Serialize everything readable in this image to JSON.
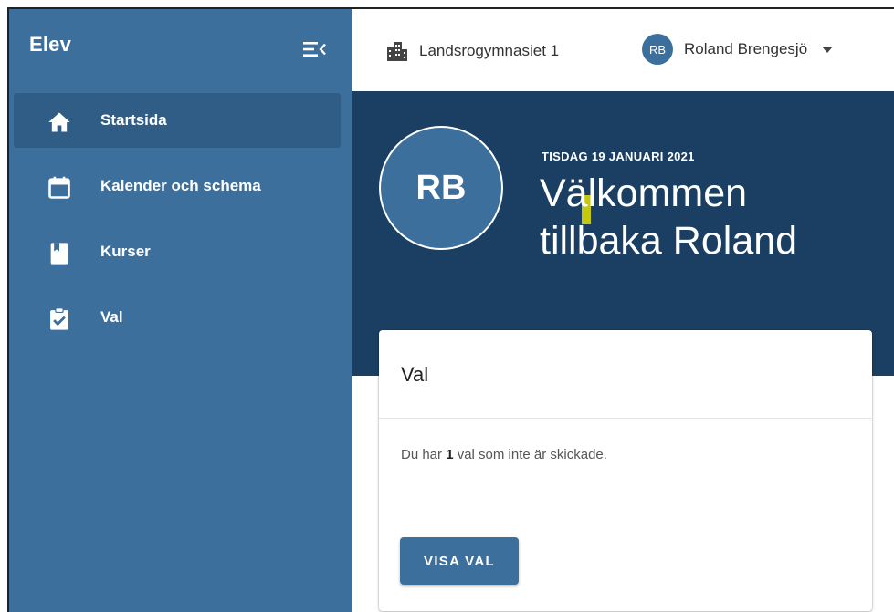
{
  "sidebar": {
    "app_title": "Elev",
    "collapse_icon": "menu-collapse-icon",
    "items": [
      {
        "label": "Startsida",
        "icon": "home-icon",
        "active": true
      },
      {
        "label": "Kalender och schema",
        "icon": "calendar-icon",
        "active": false
      },
      {
        "label": "Kurser",
        "icon": "book-icon",
        "active": false
      },
      {
        "label": "Val",
        "icon": "clipboard-check-icon",
        "active": false
      }
    ]
  },
  "topbar": {
    "school_icon": "building-icon",
    "school_name": "Landsrogymnasiet 1",
    "user_initials": "RB",
    "user_name": "Roland Brengesjö"
  },
  "hero": {
    "initials": "RB",
    "date": "TISDAG 19 JANUARI 2021",
    "welcome_line1": "Välkommen",
    "welcome_line2": "tillbaka Roland"
  },
  "card": {
    "title": "Val",
    "text_prefix": "Du har ",
    "count": "1",
    "text_suffix": " val som inte är skickade.",
    "button_label": "VISA VAL"
  },
  "colors": {
    "sidebar": "#3d6f9c",
    "sidebar_active": "#2f5d85",
    "hero": "#1b3f63",
    "button": "#3d6f9c"
  }
}
